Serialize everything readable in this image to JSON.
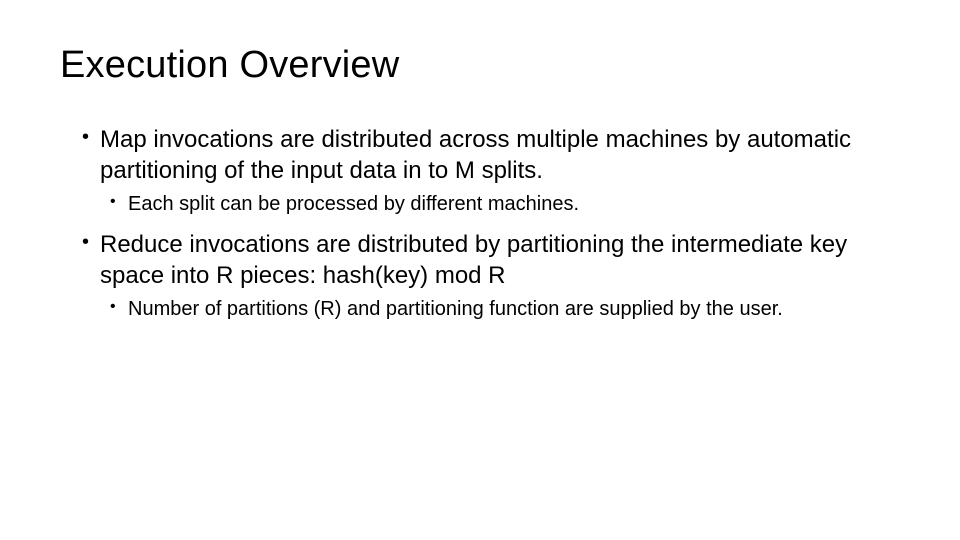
{
  "title": "Execution Overview",
  "bullets": {
    "b1": {
      "text": "Map invocations are distributed across multiple machines by automatic partitioning of the input data in to M splits.",
      "sub": "Each split can be processed by different machines."
    },
    "b2": {
      "text": "Reduce invocations are distributed by partitioning the intermediate key space into R pieces: hash(key) mod R",
      "sub": "Number of partitions (R) and partitioning function are supplied by the user."
    }
  }
}
